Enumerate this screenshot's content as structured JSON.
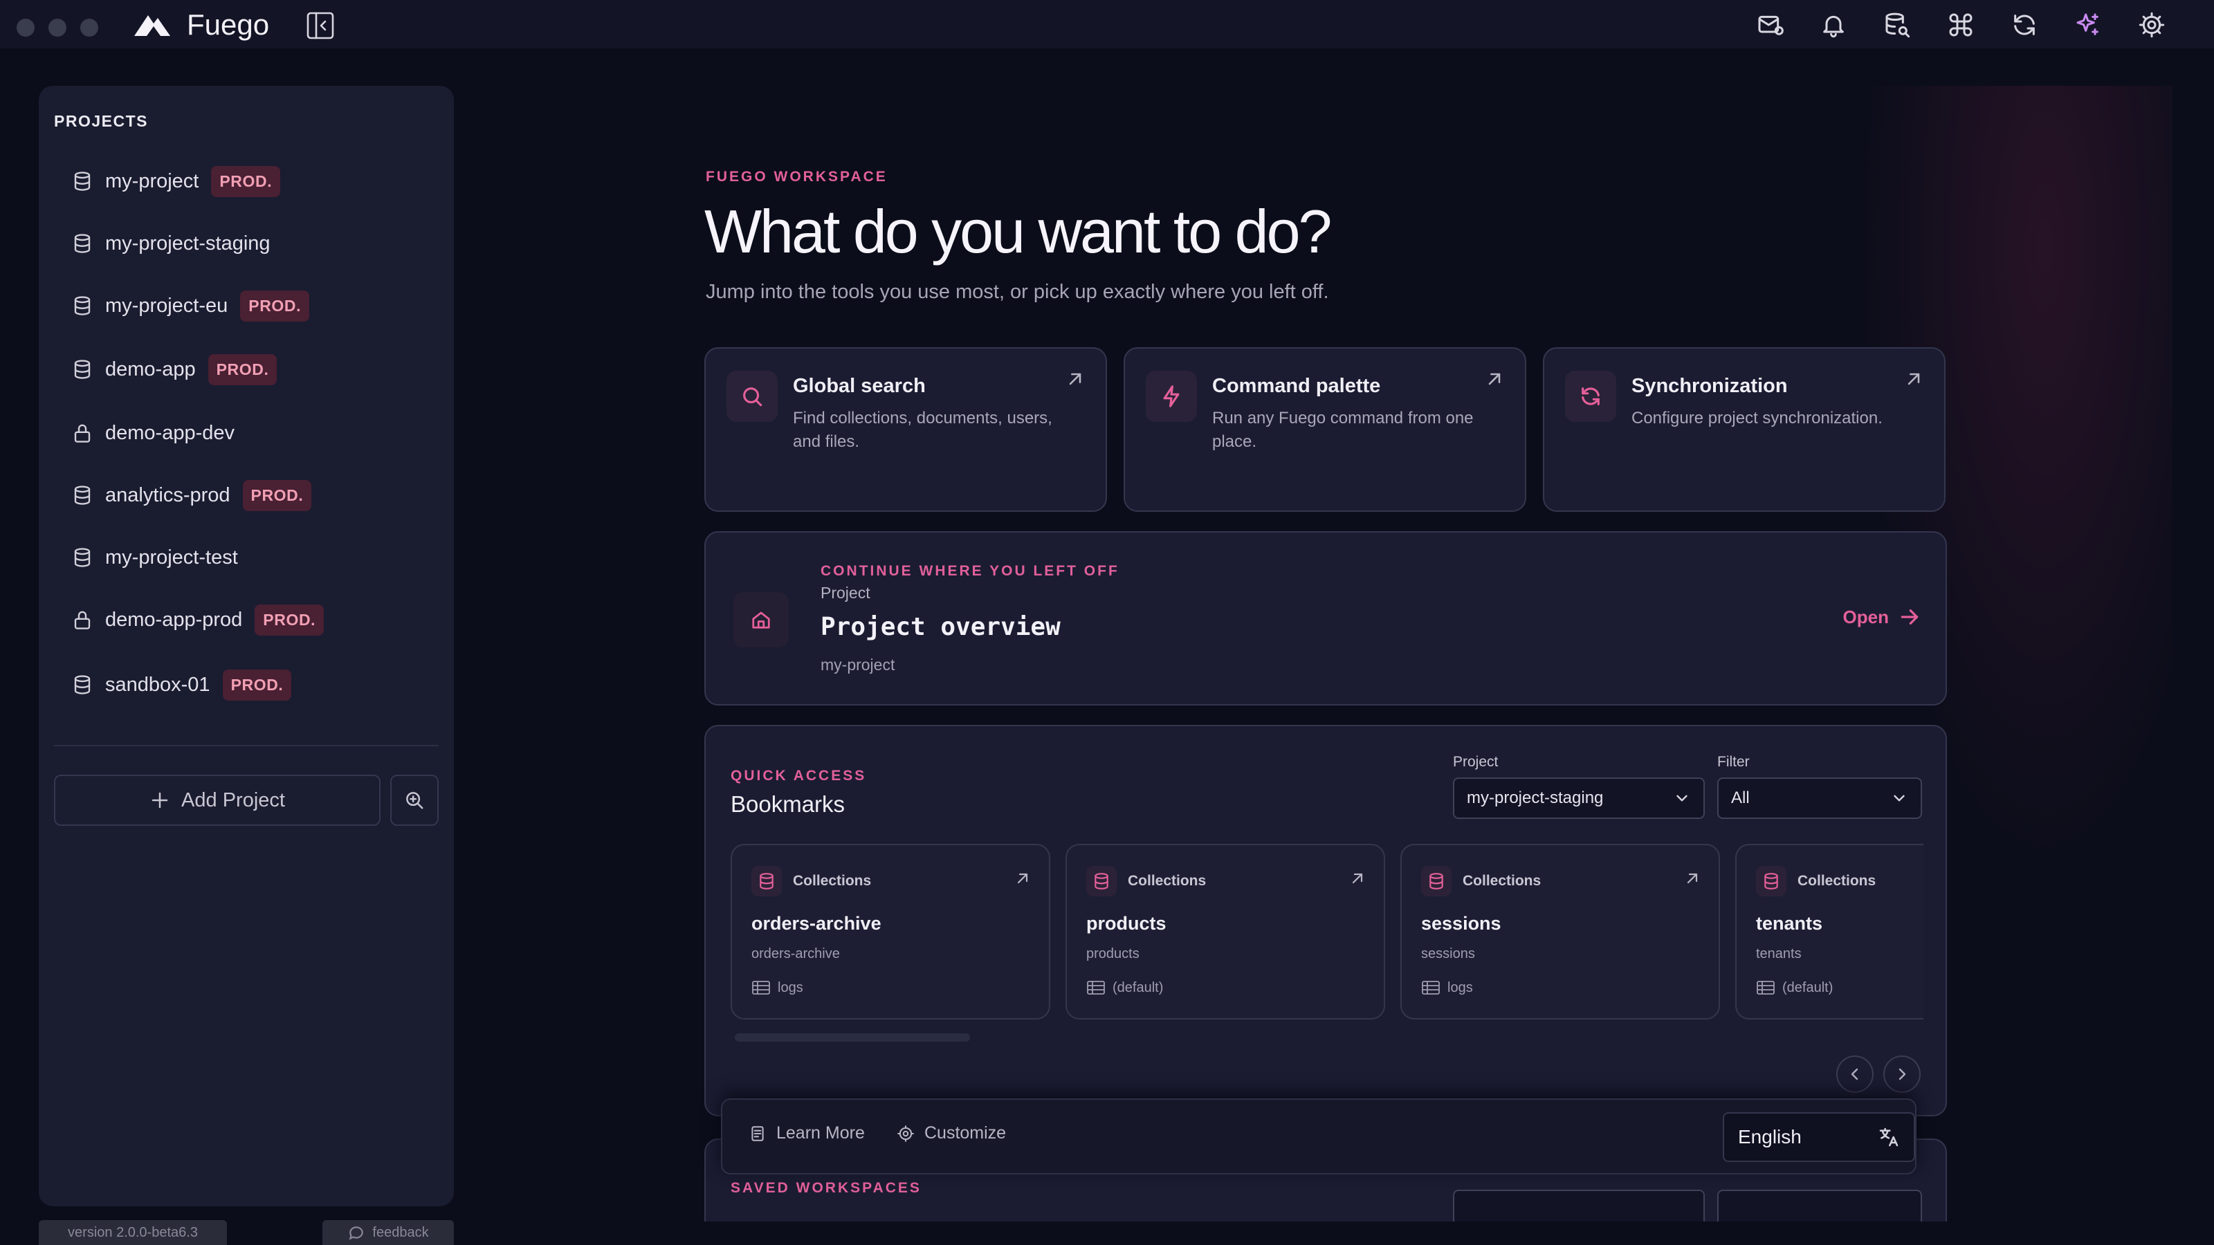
{
  "app": {
    "title": "Fuego"
  },
  "sidebar": {
    "heading": "PROJECTS",
    "projects": [
      {
        "name": "my-project",
        "badge": "PROD.",
        "icon": "database-icon"
      },
      {
        "name": "my-project-staging",
        "badge": "",
        "icon": "database-icon"
      },
      {
        "name": "my-project-eu",
        "badge": "PROD.",
        "icon": "database-icon"
      },
      {
        "name": "demo-app",
        "badge": "PROD.",
        "icon": "database-icon"
      },
      {
        "name": "demo-app-dev",
        "badge": "",
        "icon": "lock-icon"
      },
      {
        "name": "analytics-prod",
        "badge": "PROD.",
        "icon": "database-icon"
      },
      {
        "name": "my-project-test",
        "badge": "",
        "icon": "database-icon"
      },
      {
        "name": "demo-app-prod",
        "badge": "PROD.",
        "icon": "lock-icon"
      },
      {
        "name": "sandbox-01",
        "badge": "PROD.",
        "icon": "database-icon"
      }
    ],
    "add_project": "Add Project",
    "version": "version 2.0.0-beta6.3",
    "feedback": "feedback"
  },
  "hero": {
    "eyebrow": "FUEGO WORKSPACE",
    "title": "What do you want to do?",
    "subtitle": "Jump into the tools you use most, or pick up exactly where you left off."
  },
  "quick_actions": [
    {
      "title": "Global search",
      "desc": "Find collections, documents, users, and files.",
      "icon": "search-icon"
    },
    {
      "title": "Command palette",
      "desc": "Run any Fuego command from one place.",
      "icon": "bolt-icon"
    },
    {
      "title": "Synchronization",
      "desc": "Configure project synchronization.",
      "icon": "sync-icon"
    }
  ],
  "continue": {
    "eyebrow": "CONTINUE WHERE YOU LEFT OFF",
    "kind": "Project",
    "title": "Project overview",
    "project": "my-project",
    "open": "Open"
  },
  "quick_access": {
    "eyebrow": "QUICK ACCESS",
    "title": "Bookmarks",
    "project_label": "Project",
    "project_value": "my-project-staging",
    "filter_label": "Filter",
    "filter_value": "All",
    "bookmarks": [
      {
        "category": "Collections",
        "name": "orders-archive",
        "sub": "orders-archive",
        "db": "logs"
      },
      {
        "category": "Collections",
        "name": "products",
        "sub": "products",
        "db": "(default)"
      },
      {
        "category": "Collections",
        "name": "sessions",
        "sub": "sessions",
        "db": "logs"
      },
      {
        "category": "Collections",
        "name": "tenants",
        "sub": "tenants",
        "db": "(default)"
      }
    ]
  },
  "saved": {
    "eyebrow": "SAVED WORKSPACES"
  },
  "bottombar": {
    "learn_more": "Learn More",
    "customize": "Customize",
    "language": "English"
  },
  "colors": {
    "accent": "#e5609a",
    "badge_bg": "#4a2033",
    "badge_fg": "#f2a0b4",
    "bg": "#0b0d1a",
    "card": "#1b1c31"
  }
}
